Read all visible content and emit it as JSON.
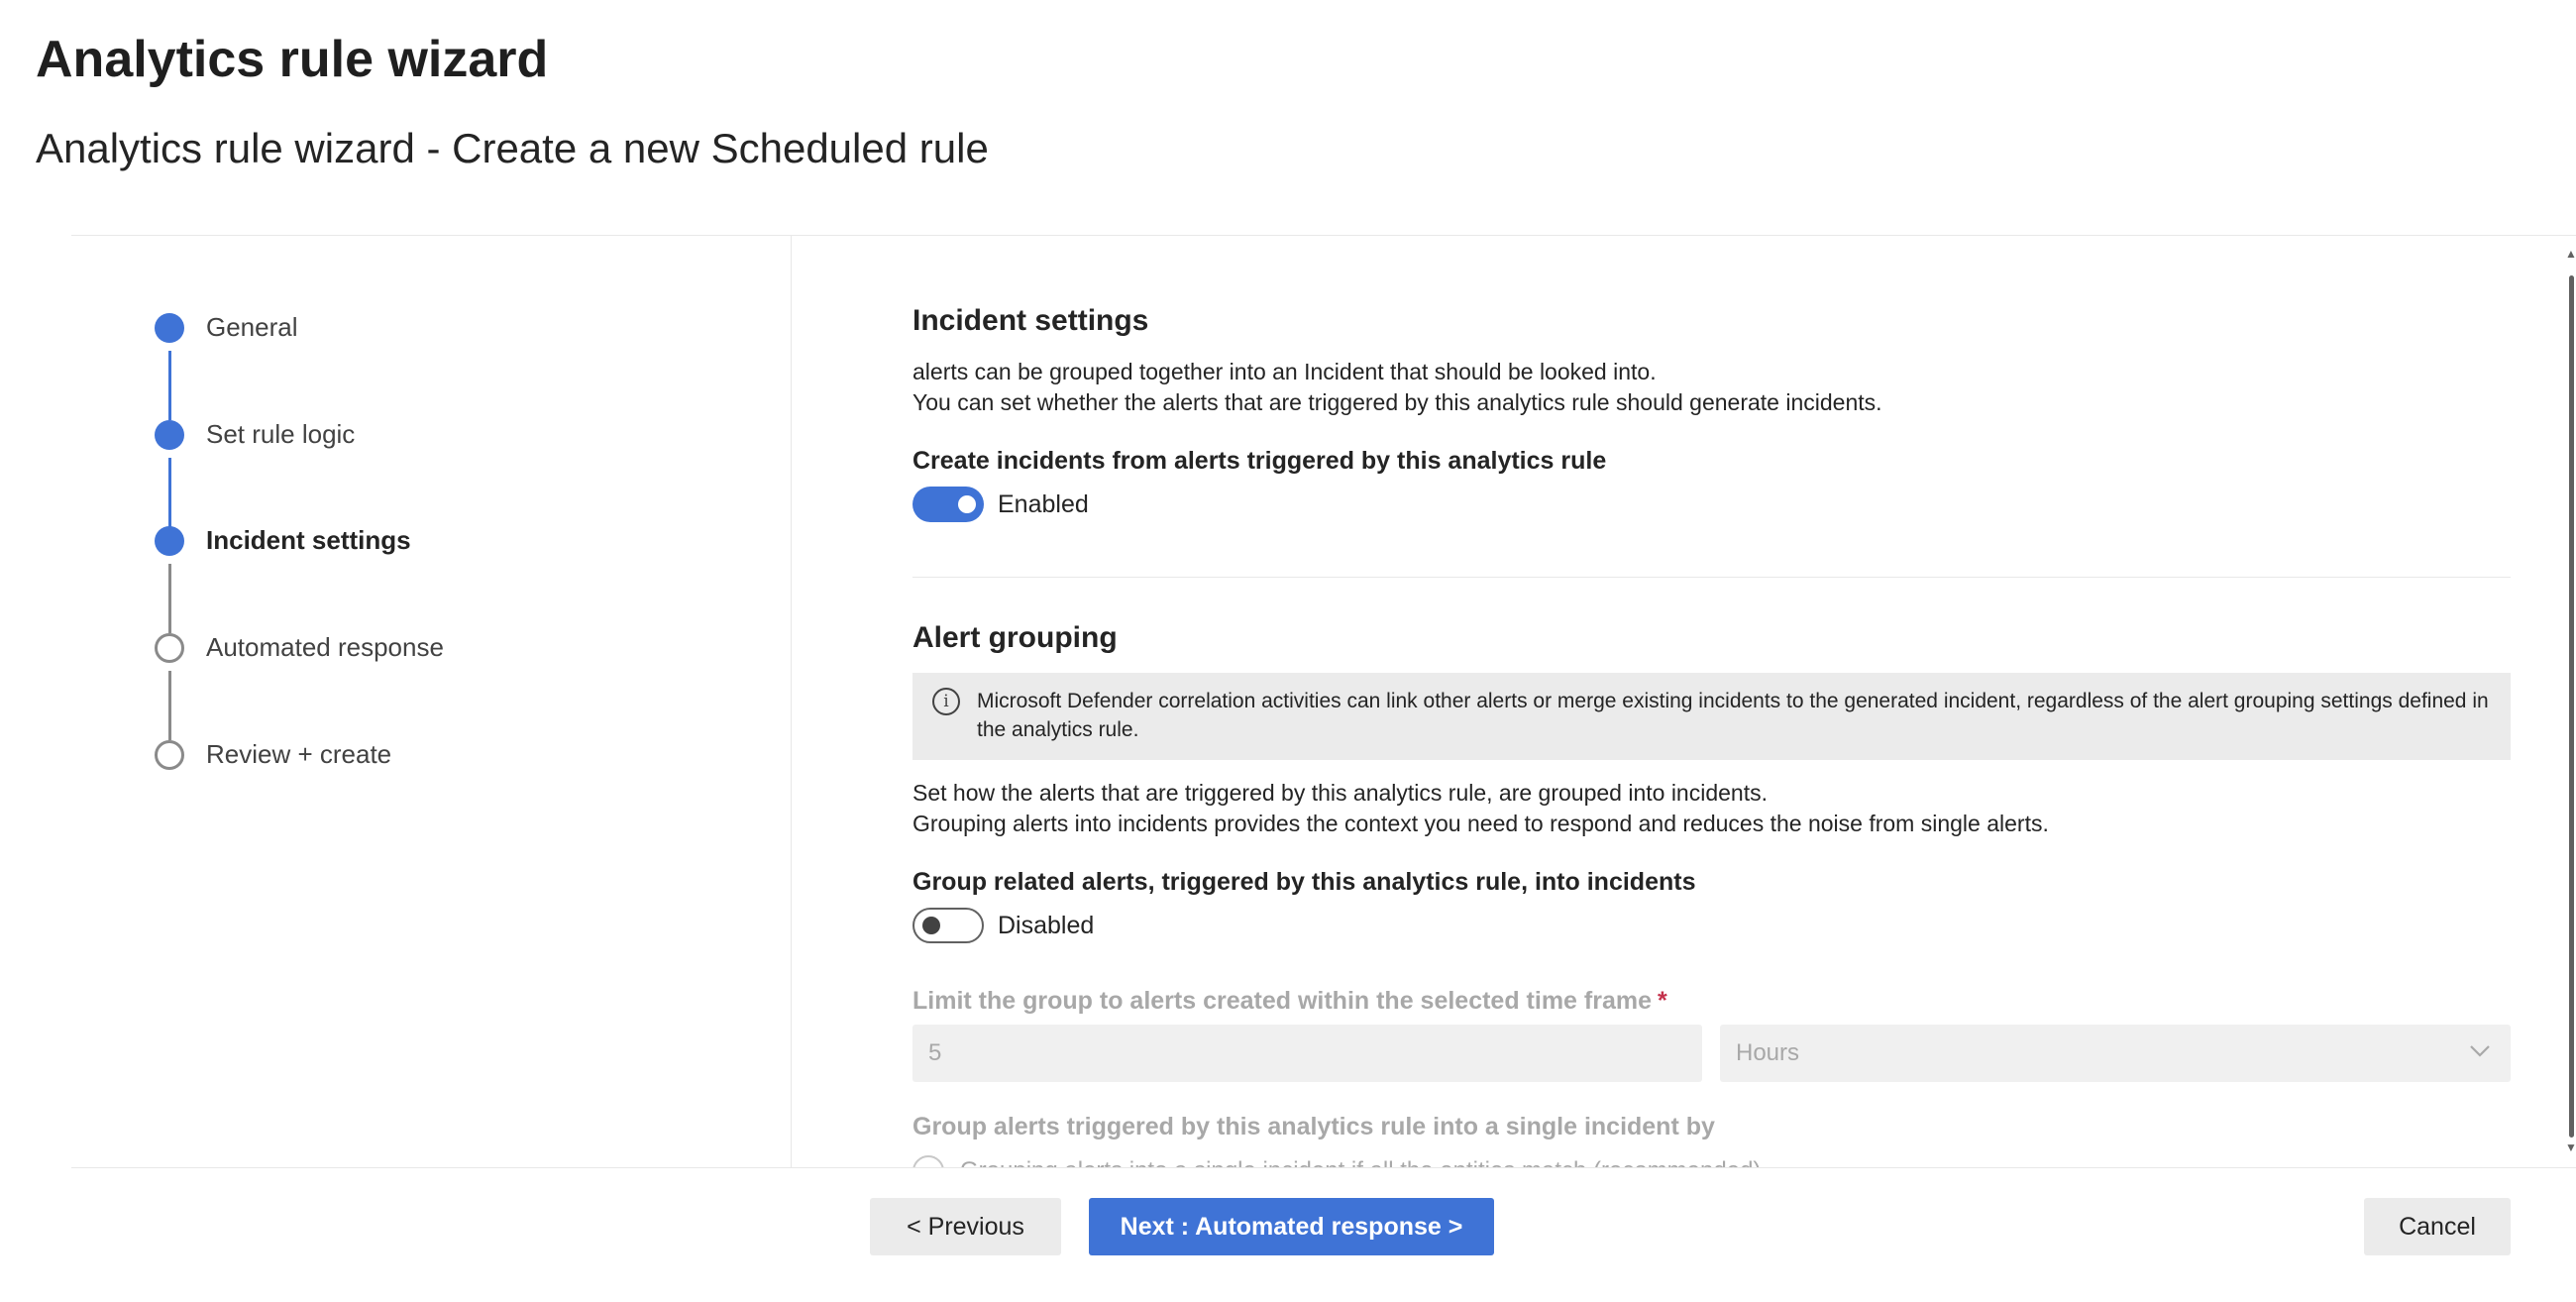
{
  "page": {
    "title": "Analytics rule wizard",
    "subtitle": "Analytics rule wizard - Create a new Scheduled rule"
  },
  "steps": [
    {
      "label": "General",
      "state": "completed"
    },
    {
      "label": "Set rule logic",
      "state": "completed"
    },
    {
      "label": "Incident settings",
      "state": "current"
    },
    {
      "label": "Automated response",
      "state": "upcoming"
    },
    {
      "label": "Review + create",
      "state": "upcoming"
    }
  ],
  "incident_settings": {
    "title": "Incident settings",
    "desc_line1": "alerts can be grouped together into an Incident that should be looked into.",
    "desc_line2": "You can set whether the alerts that are triggered by this analytics rule should generate incidents.",
    "create_label": "Create incidents from alerts triggered by this analytics rule",
    "create_toggle_state": "Enabled",
    "create_toggle_on": true
  },
  "alert_grouping": {
    "title": "Alert grouping",
    "info_text": "Microsoft Defender correlation activities can link other alerts or merge existing incidents to the generated incident, regardless of the alert grouping settings defined in the analytics rule.",
    "desc_line1": "Set how the alerts that are triggered by this analytics rule, are grouped into incidents.",
    "desc_line2": "Grouping alerts into incidents provides the context you need to respond and reduces the noise from single alerts.",
    "group_label": "Group related alerts, triggered by this analytics rule, into incidents",
    "group_toggle_state": "Disabled",
    "group_toggle_on": false,
    "limit_label": "Limit the group to alerts created within the selected time frame",
    "required_mark": "*",
    "limit_value": "5",
    "limit_unit": "Hours",
    "group_by_label": "Group alerts triggered by this analytics rule into a single incident by",
    "radio_partial_text": "Grouping alerts into a single incident if all the entities match (recommended)"
  },
  "footer": {
    "previous": "< Previous",
    "next": "Next : Automated response >",
    "cancel": "Cancel"
  },
  "colors": {
    "accent": "#3f73d6",
    "disabled_text": "#a8a8a8",
    "info_background": "#ebebeb"
  },
  "icons": [
    "info-icon",
    "chevron-down-icon",
    "scroll-up-arrow-icon",
    "scroll-down-arrow-icon"
  ]
}
